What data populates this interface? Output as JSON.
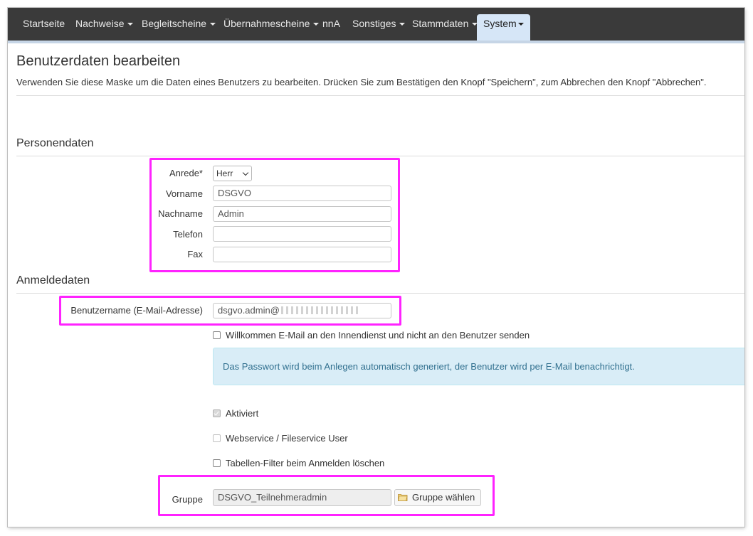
{
  "nav": {
    "items": [
      {
        "label": "Startseite",
        "dropdown": false
      },
      {
        "label": "Nachweise",
        "dropdown": true
      },
      {
        "label": "Begleitscheine",
        "dropdown": true
      },
      {
        "label": "Übernahmescheine",
        "dropdown": true
      },
      {
        "label": "nnA",
        "dropdown": false
      },
      {
        "label": "Sonstiges",
        "dropdown": true
      },
      {
        "label": "Stammdaten",
        "dropdown": true
      },
      {
        "label": "System",
        "dropdown": true,
        "active": true
      }
    ]
  },
  "page": {
    "title": "Benutzerdaten bearbeiten",
    "description": "Verwenden Sie diese Maske um die Daten eines Benutzers zu bearbeiten. Drücken Sie zum Bestätigen den Knopf \"Speichern\", zum Abbrechen den Knopf \"Abbrechen\"."
  },
  "personal": {
    "heading": "Personendaten",
    "anrede_label": "Anrede*",
    "anrede_value": "Herr",
    "vorname_label": "Vorname",
    "vorname_value": "DSGVO",
    "nachname_label": "Nachname",
    "nachname_value": "Admin",
    "telefon_label": "Telefon",
    "telefon_value": "",
    "fax_label": "Fax",
    "fax_value": ""
  },
  "login": {
    "heading": "Anmeldedaten",
    "username_label": "Benutzername (E-Mail-Adresse)",
    "username_value": "dsgvo.admin@",
    "welcome_mail_label": "Willkommen E-Mail an den Innendienst und nicht an den Benutzer senden",
    "welcome_mail_checked": false,
    "info_text": "Das Passwort wird beim Anlegen automatisch generiert, der Benutzer wird per E-Mail benachrichtigt.",
    "aktiviert_label": "Aktiviert",
    "aktiviert_checked": true,
    "webservice_label": "Webservice / Fileservice User",
    "webservice_checked": false,
    "filter_label": "Tabellen-Filter beim Anmelden löschen",
    "filter_checked": false,
    "gruppe_label": "Gruppe",
    "gruppe_value": "DSGVO_Teilnehmeradmin",
    "gruppe_button": "Gruppe wählen"
  },
  "colors": {
    "navbar": "#3a3a3a",
    "nav_active": "#d6e6f7",
    "highlight": "#ff23ff",
    "info_bg": "#d9edf7",
    "info_text": "#31708f"
  },
  "icons": {
    "caret": "caret-down-icon",
    "select": "chevron-down-icon",
    "group_button": "folder-icon"
  }
}
